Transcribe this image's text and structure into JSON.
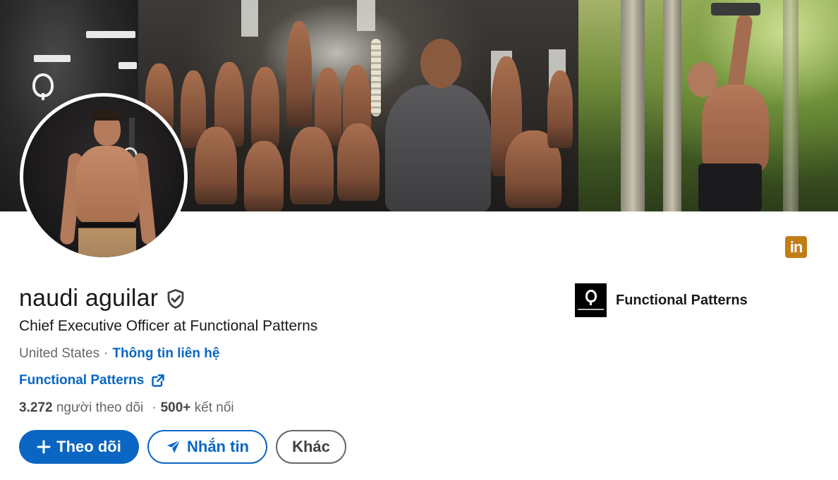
{
  "profile": {
    "name": "naudi aguilar",
    "headline": "Chief Executive Officer at Functional Patterns",
    "location": "United States",
    "location_separator": "·",
    "contact_info_label": "Thông tin liên hệ",
    "website_label": "Functional Patterns",
    "followers_count": "3.272",
    "followers_label": "người theo dõi",
    "stats_separator": "·",
    "connections_count": "500+",
    "connections_label": "kết nối"
  },
  "actions": {
    "follow_label": "Theo dõi",
    "message_label": "Nhắn tin",
    "more_label": "Khác"
  },
  "current_company": {
    "name": "Functional Patterns"
  },
  "badge": {
    "text": "in",
    "color": "#c37d16"
  },
  "icons": {
    "verified": "shield-check-icon",
    "external_link": "external-link-icon",
    "follow": "plus-icon",
    "message": "paper-plane-icon"
  },
  "colors": {
    "primary": "#0a66c2",
    "text": "#191919",
    "muted": "#666666"
  }
}
